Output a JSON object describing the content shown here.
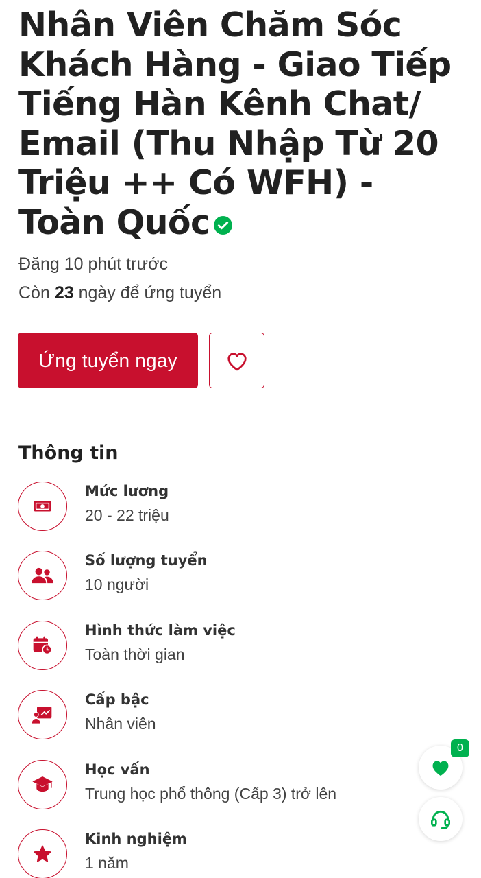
{
  "job": {
    "title": "Nhân Viên Chăm Sóc Khách Hàng - Giao Tiếp Tiếng Hàn Kênh Chat/ Email (Thu Nhập Từ 20 Triệu ++ Có WFH) - Toàn Quốc",
    "verified_icon": "check-circle-icon",
    "posted": "Đăng 10 phút trước",
    "remaining_prefix": "Còn ",
    "remaining_days": "23",
    "remaining_suffix": " ngày để ứng tuyển"
  },
  "actions": {
    "apply_label": "Ứng tuyển ngay",
    "save_icon": "heart-outline-icon"
  },
  "info": {
    "title": "Thông tin",
    "items": [
      {
        "label": "Mức lương",
        "value": "20 - 22 triệu",
        "icon": "money-icon"
      },
      {
        "label": "Số lượng tuyển",
        "value": "10 người",
        "icon": "users-icon"
      },
      {
        "label": "Hình thức làm việc",
        "value": "Toàn thời gian",
        "icon": "calendar-clock-icon"
      },
      {
        "label": "Cấp bậc",
        "value": "Nhân viên",
        "icon": "presentation-icon"
      },
      {
        "label": "Học vấn",
        "value": "Trung học phổ thông (Cấp 3) trở lên",
        "icon": "graduation-cap-icon"
      },
      {
        "label": "Kinh nghiệm",
        "value": "1 năm",
        "icon": "star-icon"
      }
    ]
  },
  "floating": {
    "favorites_count": "0",
    "favorites_icon": "heart-icon",
    "support_icon": "headset-icon"
  },
  "colors": {
    "brand_red": "#c8102e",
    "brand_green": "#00b14f",
    "text": "#212121"
  }
}
